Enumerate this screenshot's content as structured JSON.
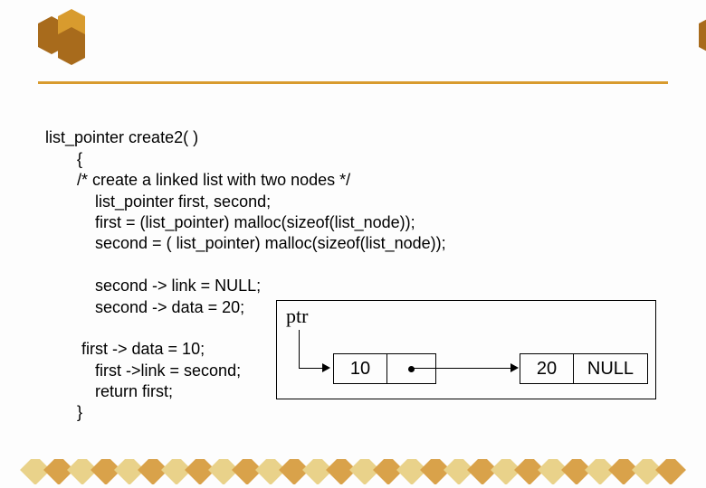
{
  "code": {
    "l1": "list_pointer create2( )",
    "l2": "       {",
    "l3": "       /* create a linked list with two nodes */",
    "l4": "           list_pointer first, second;",
    "l5": "           first = (list_pointer) malloc(sizeof(list_node));",
    "l6": "           second = ( list_pointer) malloc(sizeof(list_node));",
    "l7": "",
    "l8": "           second -> link = NULL;",
    "l9": "           second -> data = 20;",
    "l10": "",
    "l11": "        first -> data = 10;",
    "l12": "           first ->link = second;",
    "l13": "           return first;",
    "l14": "       }"
  },
  "figure": {
    "ptr_label": "ptr",
    "node1": {
      "data": "10",
      "link_dot": "•"
    },
    "node2": {
      "data": "20",
      "null": "NULL"
    }
  }
}
